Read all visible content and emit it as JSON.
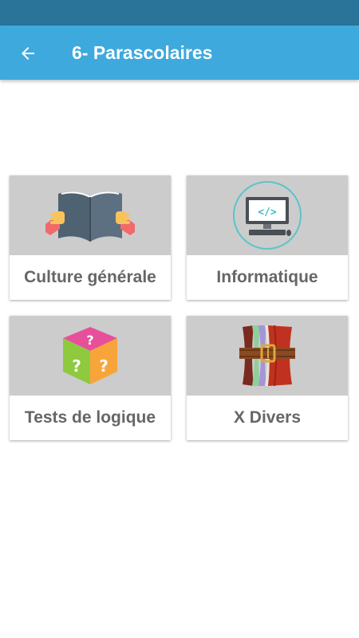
{
  "app_bar": {
    "title": "6- Parascolaires",
    "back_icon": "arrow-left-icon",
    "background": "#3ea9dd",
    "status_bar_color": "#2a7399"
  },
  "categories": [
    {
      "label": "Culture générale",
      "icon": "open-book-icon"
    },
    {
      "label": "Informatique",
      "icon": "computer-code-icon"
    },
    {
      "label": "Tests de logique",
      "icon": "question-cube-icon"
    },
    {
      "label": "X Divers",
      "icon": "belted-books-icon"
    }
  ]
}
